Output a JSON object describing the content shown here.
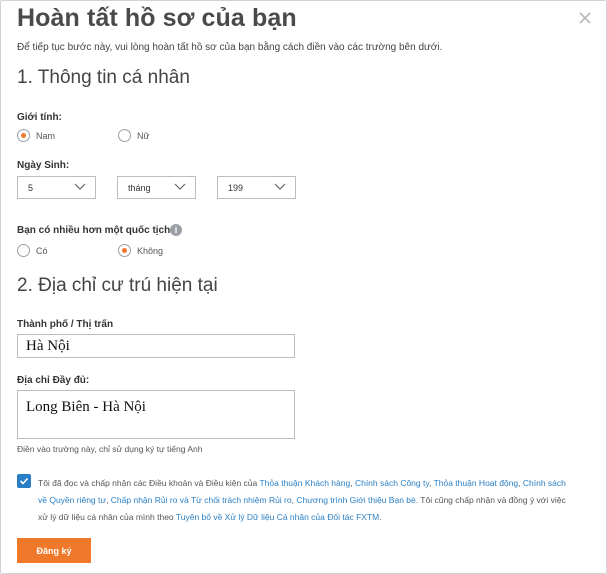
{
  "header": {
    "title": "Hoàn tất hồ sơ của bạn",
    "intro": "Để tiếp tục bước này, vui lòng hoàn tất hồ sơ của bạn bằng cách điền vào các trường bên dưới."
  },
  "personal": {
    "section_title": "1. Thông tin cá nhân",
    "gender_label": "Giới tính:",
    "gender_options": [
      "Nam",
      "Nữ"
    ],
    "gender_selected": "Nam",
    "birth_label": "Ngày Sinh:",
    "birth_day": "5",
    "birth_month": "tháng",
    "birth_year": "199",
    "citizenship_label": "Bạn có nhiều hơn một quốc tịch?",
    "citizenship_options": [
      "Có",
      "Không"
    ],
    "citizenship_selected": "Không"
  },
  "address": {
    "section_title": "2. Địa chỉ cư trú hiện tại",
    "city_label": "Thành phố / Thị trấn",
    "city_value": "Hà Nội",
    "full_label": "Địa chỉ Đầy đủ:",
    "full_value": "Long Biên - Hà Nội",
    "hint": "Điền vào trường này, chỉ sử dụng ký tự tiếng Anh"
  },
  "consent": {
    "checked": true,
    "t1": "Tôi đã đọc và chấp nhận các Điều khoản và Điều kiện của ",
    "l1": "Thỏa thuận Khách hàng",
    "l2": "Chính sách Công ty",
    "l3": "Thỏa thuận Hoạt động",
    "l4": "Chính sách về Quyền riêng tư",
    "l5": "Chấp nhận Rủi ro và Từ chối trách nhiệm Rủi ro",
    "l6": "Chương trình Giới thiệu Bạn bè",
    "t2": ". Tôi cũng chấp nhận và đồng ý với việc xử lý dữ liệu cá nhân của mình theo ",
    "l7": "Tuyên bố về Xử lý Dữ liệu Cá nhân của Đối tác FXTM",
    "sep": ", ",
    "end": "."
  },
  "actions": {
    "submit_label": "Đăng ký"
  },
  "colors": {
    "accent": "#f0782a",
    "link": "#2a7fc4"
  },
  "icons": [
    "close-icon",
    "info-icon",
    "chevron-down-icon",
    "checkmark-icon"
  ]
}
